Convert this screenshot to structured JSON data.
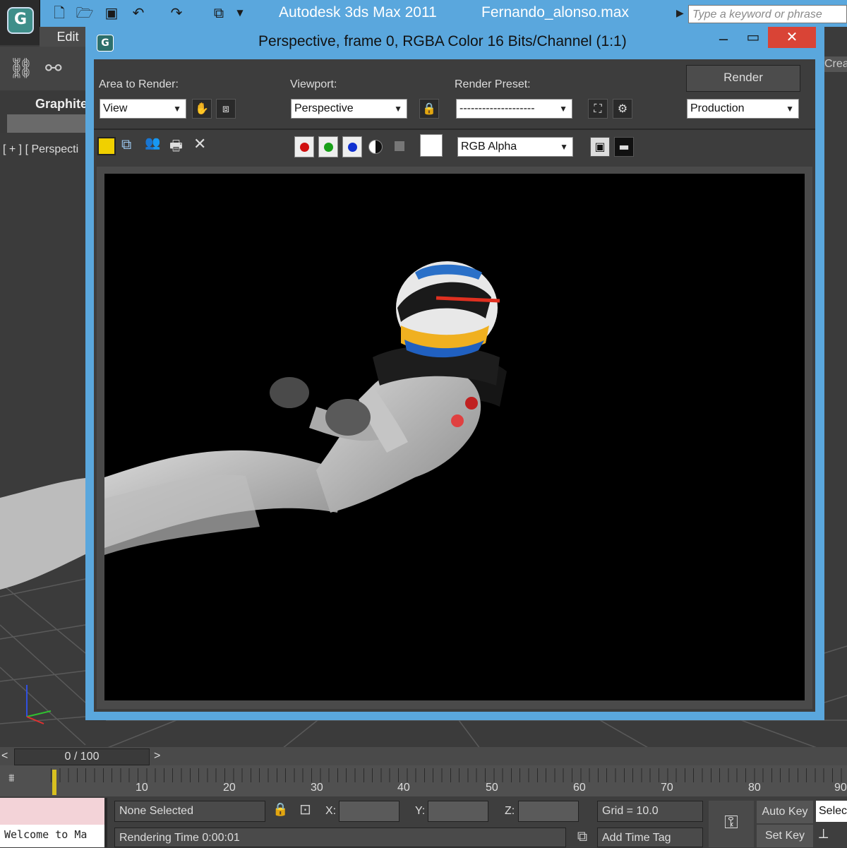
{
  "app": {
    "title": "Autodesk 3ds Max  2011",
    "file": "Fernando_alonso.max",
    "search_placeholder": "Type a keyword or phrase",
    "menu_edit": "Edit",
    "ribbon_label": "Graphite",
    "viewport_label": "[ + ] [ Perspecti",
    "create_tab": "Crea"
  },
  "render_window": {
    "title": "Perspective, frame 0, RGBA Color 16 Bits/Channel (1:1)",
    "area_label": "Area to Render:",
    "area_value": "View",
    "viewport_label": "Viewport:",
    "viewport_value": "Perspective",
    "preset_label": "Render Preset:",
    "preset_value": "--------------------",
    "render_button": "Render",
    "mode_value": "Production",
    "channel_value": "RGB Alpha",
    "colors": {
      "red": "#d01010",
      "green": "#18a018",
      "blue": "#1030d0",
      "accent": "#5aa7dd",
      "close": "#d94436"
    }
  },
  "timeline": {
    "frame": "0 / 100",
    "ticks": [
      "10",
      "20",
      "30",
      "40",
      "50",
      "60",
      "70",
      "80",
      "90"
    ]
  },
  "status": {
    "welcome": "Welcome to Ma",
    "selection": "None Selected",
    "rendering_time": "Rendering Time  0:00:01",
    "x_label": "X:",
    "y_label": "Y:",
    "z_label": "Z:",
    "grid": "Grid = 10.0",
    "add_time_tag": "Add Time Tag",
    "auto_key": "Auto Key",
    "set_key": "Set Key",
    "selected_dd": "Selected"
  },
  "icons": [
    "app-logo-icon",
    "new-icon",
    "open-icon",
    "save-icon",
    "undo-icon",
    "redo-icon",
    "link-icon",
    "unlink-icon",
    "pan-icon",
    "crop-icon",
    "lock-icon",
    "save-image-icon",
    "clone-icon",
    "print-icon",
    "clear-icon",
    "key-icon",
    "time-config-icon",
    "display-channel-icon",
    "toggle-ui-icon"
  ]
}
